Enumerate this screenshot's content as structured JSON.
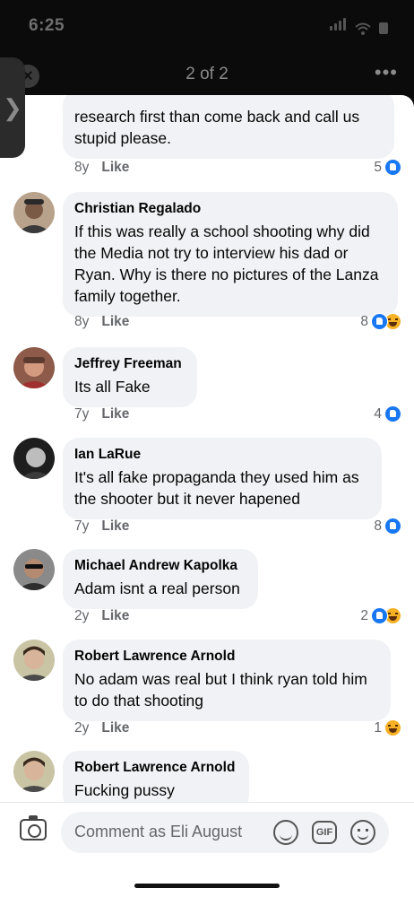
{
  "status_bar": {
    "time": "6:25"
  },
  "top_bar": {
    "close_icon": "close-icon",
    "pager": "2 of 2",
    "more": "•••",
    "side_tab": "❯"
  },
  "comments": [
    {
      "name": "",
      "text": "research first than come back and call us stupid please.",
      "age": "8y",
      "like_label": "Like",
      "reaction_count": "5",
      "reactions": [
        "like"
      ]
    },
    {
      "name": "Christian Regalado",
      "text": "If this was really a school shooting why did the Media not try to interview his dad or Ryan. Why is there no pictures of the Lanza family together.",
      "age": "8y",
      "like_label": "Like",
      "reaction_count": "8",
      "reactions": [
        "like",
        "haha"
      ]
    },
    {
      "name": "Jeffrey Freeman",
      "text": "Its all Fake",
      "age": "7y",
      "like_label": "Like",
      "reaction_count": "4",
      "reactions": [
        "like"
      ]
    },
    {
      "name": "Ian LaRue",
      "text": "It's all fake propaganda they used him as the shooter but it never hapened",
      "age": "7y",
      "like_label": "Like",
      "reaction_count": "8",
      "reactions": [
        "like"
      ]
    },
    {
      "name": "Michael Andrew Kapolka",
      "text": "Adam isnt a real person",
      "age": "2y",
      "like_label": "Like",
      "reaction_count": "2",
      "reactions": [
        "like",
        "haha"
      ]
    },
    {
      "name": "Robert Lawrence Arnold",
      "text": "No adam was real but I think ryan told him to do that shooting",
      "age": "2y",
      "like_label": "Like",
      "reaction_count": "1",
      "reactions": [
        "haha"
      ]
    },
    {
      "name": "Robert Lawrence Arnold",
      "text": "Fucking pussy",
      "age": "",
      "like_label": "",
      "reaction_count": "",
      "reactions": []
    }
  ],
  "composer": {
    "placeholder": "Comment as Eli August",
    "gif_label": "GIF"
  },
  "colors": {
    "like_blue": "#1877f2",
    "haha_yellow": "#f7b125",
    "bubble_bg": "#f0f2f5",
    "meta_gray": "#65676b"
  }
}
